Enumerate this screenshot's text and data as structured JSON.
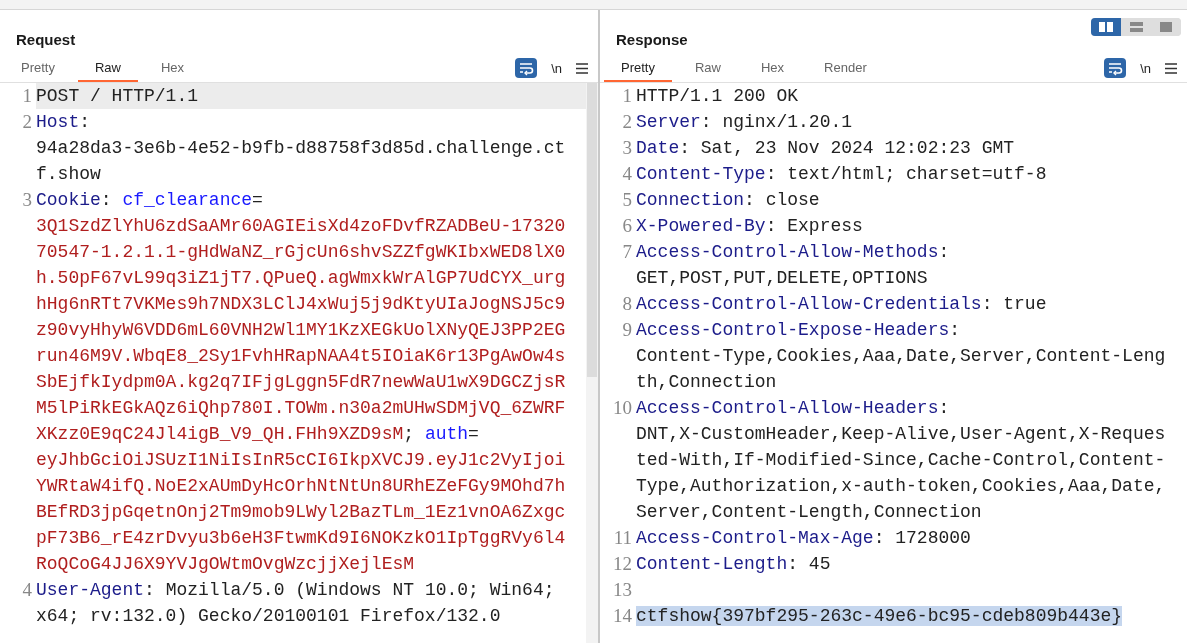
{
  "request": {
    "title": "Request",
    "tabs": [
      {
        "label": "Pretty",
        "selected": false
      },
      {
        "label": "Raw",
        "selected": true
      },
      {
        "label": "Hex",
        "selected": false
      }
    ],
    "newline_toggle": "\\n",
    "lines": [
      {
        "number": "1",
        "current": true,
        "selected": false,
        "rows": [
          {
            "parts": [
              {
                "kind": "text",
                "text": "POST / HTTP/1.1"
              }
            ]
          }
        ]
      },
      {
        "number": "2",
        "current": false,
        "selected": false,
        "rows": [
          {
            "parts": [
              {
                "kind": "name",
                "text": "Host"
              },
              {
                "kind": "text",
                "text": ":"
              }
            ]
          },
          {
            "parts": [
              {
                "kind": "text",
                "text": "94a28da3-3e6b-4e52-b9fb-d88758f3d85d.challenge.ct"
              }
            ]
          },
          {
            "parts": [
              {
                "kind": "text",
                "text": "f.show"
              }
            ]
          }
        ]
      },
      {
        "number": "3",
        "current": false,
        "selected": false,
        "rows": [
          {
            "parts": [
              {
                "kind": "name",
                "text": "Cookie"
              },
              {
                "kind": "text",
                "text": ": "
              },
              {
                "kind": "param",
                "text": "cf_clearance"
              },
              {
                "kind": "text",
                "text": "="
              }
            ]
          },
          {
            "parts": [
              {
                "kind": "value",
                "text": "3Q1SzdZlYhU6zdSaAMr60AGIEisXd4zoFDvfRZADBeU-17320"
              }
            ]
          },
          {
            "parts": [
              {
                "kind": "value",
                "text": "70547-1.2.1.1-gHdWaNZ_rGjcUn6shvSZZfgWKIbxWED8lX0"
              }
            ]
          },
          {
            "parts": [
              {
                "kind": "value",
                "text": "h.50pF67vL99q3iZ1jT7.QPueQ.agWmxkWrAlGP7UdCYX_urg"
              }
            ]
          },
          {
            "parts": [
              {
                "kind": "value",
                "text": "hHg6nRTt7VKMes9h7NDX3LClJ4xWuj5j9dKtyUIaJogNSJ5c9"
              }
            ]
          },
          {
            "parts": [
              {
                "kind": "value",
                "text": "z90vyHhyW6VDD6mL60VNH2Wl1MY1KzXEGkUolXNyQEJ3PP2EG"
              }
            ]
          },
          {
            "parts": [
              {
                "kind": "value",
                "text": "run46M9V.WbqE8_2Sy1FvhHRapNAA4t5IOiaK6r13PgAwOw4s"
              }
            ]
          },
          {
            "parts": [
              {
                "kind": "value",
                "text": "SbEjfkIydpm0A.kg2q7IFjgLggn5FdR7newWaU1wX9DGCZjsR"
              }
            ]
          },
          {
            "parts": [
              {
                "kind": "value",
                "text": "M5lPiRkEGkAQz6iQhp780I.TOWm.n30a2mUHwSDMjVQ_6ZWRF"
              }
            ]
          },
          {
            "parts": [
              {
                "kind": "value",
                "text": "XKzz0E9qC24Jl4igB_V9_QH.FHh9XZD9sM"
              },
              {
                "kind": "text",
                "text": "; "
              },
              {
                "kind": "param",
                "text": "auth"
              },
              {
                "kind": "text",
                "text": "="
              }
            ]
          },
          {
            "parts": [
              {
                "kind": "value",
                "text": "eyJhbGciOiJSUzI1NiIsInR5cCI6IkpXVCJ9.eyJ1c2VyIjoi"
              }
            ]
          },
          {
            "parts": [
              {
                "kind": "value",
                "text": "YWRtaW4ifQ.NoE2xAUmDyHcOrhNtNtUn8URhEZeFGy9MOhd7h"
              }
            ]
          },
          {
            "parts": [
              {
                "kind": "value",
                "text": "BEfRD3jpGqetnOnj2Tm9mob9LWyl2BazTLm_1Ez1vnOA6Zxgc"
              }
            ]
          },
          {
            "parts": [
              {
                "kind": "value",
                "text": "pF73B6_rE4zrDvyu3b6eH3FtwmKd9I6NOKzkO1IpTggRVy6l4"
              }
            ]
          },
          {
            "parts": [
              {
                "kind": "value",
                "text": "RoQCoG4JJ6X9YVJgOWtmOvgWzcjjXejlEsM"
              }
            ]
          }
        ]
      },
      {
        "number": "4",
        "current": false,
        "selected": false,
        "rows": [
          {
            "parts": [
              {
                "kind": "name",
                "text": "User-Agent"
              },
              {
                "kind": "text",
                "text": ": Mozilla/5.0 (Windows NT 10.0; Win64;"
              }
            ]
          },
          {
            "parts": [
              {
                "kind": "text",
                "text": "x64; rv:132.0) Gecko/20100101 Firefox/132.0"
              }
            ]
          }
        ]
      }
    ]
  },
  "response": {
    "title": "Response",
    "view_modes": [
      {
        "kind": "columns",
        "selected": true
      },
      {
        "kind": "rows",
        "selected": false
      },
      {
        "kind": "single",
        "selected": false
      }
    ],
    "tabs": [
      {
        "label": "Pretty",
        "selected": true
      },
      {
        "label": "Raw",
        "selected": false
      },
      {
        "label": "Hex",
        "selected": false
      },
      {
        "label": "Render",
        "selected": false
      }
    ],
    "newline_toggle": "\\n",
    "lines": [
      {
        "number": "1",
        "current": false,
        "selected": false,
        "rows": [
          {
            "parts": [
              {
                "kind": "text",
                "text": "HTTP/1.1 200 OK"
              }
            ]
          }
        ]
      },
      {
        "number": "2",
        "current": false,
        "selected": false,
        "rows": [
          {
            "parts": [
              {
                "kind": "name",
                "text": "Server"
              },
              {
                "kind": "text",
                "text": ": nginx/1.20.1"
              }
            ]
          }
        ]
      },
      {
        "number": "3",
        "current": false,
        "selected": false,
        "rows": [
          {
            "parts": [
              {
                "kind": "name",
                "text": "Date"
              },
              {
                "kind": "text",
                "text": ": Sat, 23 Nov 2024 12:02:23 GMT"
              }
            ]
          }
        ]
      },
      {
        "number": "4",
        "current": false,
        "selected": false,
        "rows": [
          {
            "parts": [
              {
                "kind": "name",
                "text": "Content-Type"
              },
              {
                "kind": "text",
                "text": ": text/html; charset=utf-8"
              }
            ]
          }
        ]
      },
      {
        "number": "5",
        "current": false,
        "selected": false,
        "rows": [
          {
            "parts": [
              {
                "kind": "name",
                "text": "Connection"
              },
              {
                "kind": "text",
                "text": ": close"
              }
            ]
          }
        ]
      },
      {
        "number": "6",
        "current": false,
        "selected": false,
        "rows": [
          {
            "parts": [
              {
                "kind": "name",
                "text": "X-Powered-By"
              },
              {
                "kind": "text",
                "text": ": Express"
              }
            ]
          }
        ]
      },
      {
        "number": "7",
        "current": false,
        "selected": false,
        "rows": [
          {
            "parts": [
              {
                "kind": "name",
                "text": "Access-Control-Allow-Methods"
              },
              {
                "kind": "text",
                "text": ":"
              }
            ]
          },
          {
            "parts": [
              {
                "kind": "text",
                "text": "GET,POST,PUT,DELETE,OPTIONS"
              }
            ]
          }
        ]
      },
      {
        "number": "8",
        "current": false,
        "selected": false,
        "rows": [
          {
            "parts": [
              {
                "kind": "name",
                "text": "Access-Control-Allow-Credentials"
              },
              {
                "kind": "text",
                "text": ": true"
              }
            ]
          }
        ]
      },
      {
        "number": "9",
        "current": false,
        "selected": false,
        "rows": [
          {
            "parts": [
              {
                "kind": "name",
                "text": "Access-Control-Expose-Headers"
              },
              {
                "kind": "text",
                "text": ":"
              }
            ]
          },
          {
            "parts": [
              {
                "kind": "text",
                "text": "Content-Type,Cookies,Aaa,Date,Server,Content-Leng"
              }
            ]
          },
          {
            "parts": [
              {
                "kind": "text",
                "text": "th,Connection"
              }
            ]
          }
        ]
      },
      {
        "number": "10",
        "current": false,
        "selected": false,
        "rows": [
          {
            "parts": [
              {
                "kind": "name",
                "text": "Access-Control-Allow-Headers"
              },
              {
                "kind": "text",
                "text": ":"
              }
            ]
          },
          {
            "parts": [
              {
                "kind": "text",
                "text": "DNT,X-CustomHeader,Keep-Alive,User-Agent,X-Reques"
              }
            ]
          },
          {
            "parts": [
              {
                "kind": "text",
                "text": "ted-With,If-Modified-Since,Cache-Control,Content-"
              }
            ]
          },
          {
            "parts": [
              {
                "kind": "text",
                "text": "Type,Authorization,x-auth-token,Cookies,Aaa,Date,"
              }
            ]
          },
          {
            "parts": [
              {
                "kind": "text",
                "text": "Server,Content-Length,Connection"
              }
            ]
          }
        ]
      },
      {
        "number": "11",
        "current": false,
        "selected": false,
        "rows": [
          {
            "parts": [
              {
                "kind": "name",
                "text": "Access-Control-Max-Age"
              },
              {
                "kind": "text",
                "text": ": 1728000"
              }
            ]
          }
        ]
      },
      {
        "number": "12",
        "current": false,
        "selected": false,
        "rows": [
          {
            "parts": [
              {
                "kind": "name",
                "text": "Content-Length"
              },
              {
                "kind": "text",
                "text": ": 45"
              }
            ]
          }
        ]
      },
      {
        "number": "13",
        "current": false,
        "selected": false
      },
      {
        "number": "14",
        "current": false,
        "selected": true,
        "rows": [
          {
            "parts": [
              {
                "kind": "text",
                "text": "ctfshow{397bf295-263c-49e6-bc95-cdeb809b443e}"
              }
            ]
          }
        ]
      }
    ]
  }
}
